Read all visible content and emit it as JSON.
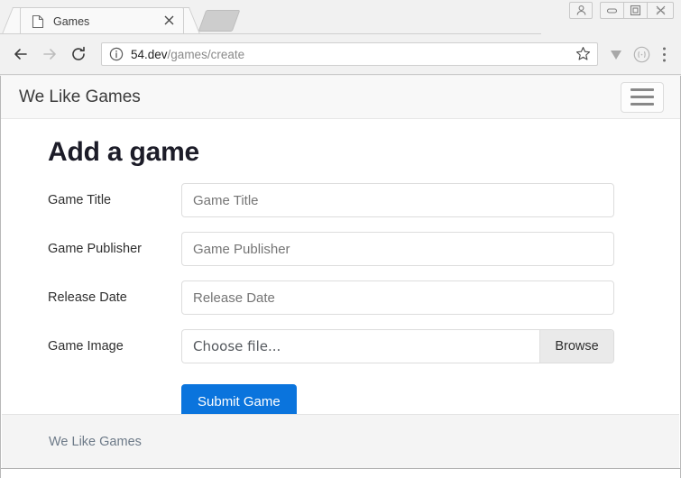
{
  "browser": {
    "tab": {
      "title": "Games",
      "favicon_icon": "page-icon",
      "close_icon": "close-icon"
    },
    "newtab_icon": "new-tab-shape",
    "window_controls": [
      {
        "name": "user-profile",
        "icon": "person-icon"
      },
      {
        "name": "minimize",
        "icon": "minimize-icon"
      },
      {
        "name": "maximize",
        "icon": "maximize-icon"
      },
      {
        "name": "close",
        "icon": "close-window-icon"
      }
    ],
    "toolbar": {
      "back_icon": "back-arrow-icon",
      "forward_icon": "forward-arrow-icon",
      "reload_icon": "reload-icon",
      "site_info_icon": "info-circle-icon",
      "url_host": "54.dev",
      "url_path": "/games/create",
      "url_full": "54.dev/games/create",
      "bookmark_icon": "star-icon",
      "download_icon": "download-triangle-icon",
      "profile_icon": "avatar-face-icon",
      "menu_icon": "three-dot-menu-icon"
    }
  },
  "page": {
    "navbar": {
      "brand": "We Like Games",
      "toggle_icon": "hamburger-icon"
    },
    "title": "Add a game",
    "form": {
      "fields": [
        {
          "label": "Game Title",
          "placeholder": "Game Title",
          "value": "",
          "type": "text"
        },
        {
          "label": "Game Publisher",
          "placeholder": "Game Publisher",
          "value": "",
          "type": "text"
        },
        {
          "label": "Release Date",
          "placeholder": "Release Date",
          "value": "",
          "type": "text"
        },
        {
          "label": "Game Image",
          "placeholder": "Choose file...",
          "value": "",
          "type": "file",
          "browse_label": "Browse"
        }
      ],
      "submit_label": "Submit Game",
      "submit_color": "#0a74dd"
    },
    "footer": {
      "text": "We Like Games"
    }
  }
}
